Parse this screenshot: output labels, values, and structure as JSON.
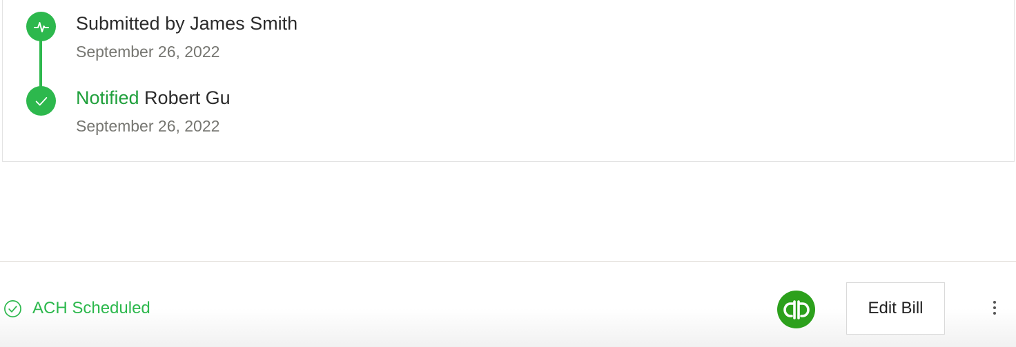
{
  "timeline": {
    "events": [
      {
        "icon": "activity-pulse-icon",
        "title": "Submitted by James Smith",
        "date": "September 26, 2022"
      },
      {
        "icon": "checkmark-icon",
        "title_highlight": "Notified",
        "title_rest": " Robert Gu",
        "date": "September 26, 2022"
      }
    ]
  },
  "footer": {
    "status_icon": "check-circle-icon",
    "status_text": "ACH Scheduled",
    "integration_logo": "quickbooks-logo",
    "edit_button_label": "Edit Bill",
    "more_icon": "more-vertical-icon"
  },
  "colors": {
    "accent_green": "#2db84d",
    "highlight_green": "#20a03c",
    "quickbooks_green": "#2ca01c",
    "date_gray": "#767671"
  }
}
